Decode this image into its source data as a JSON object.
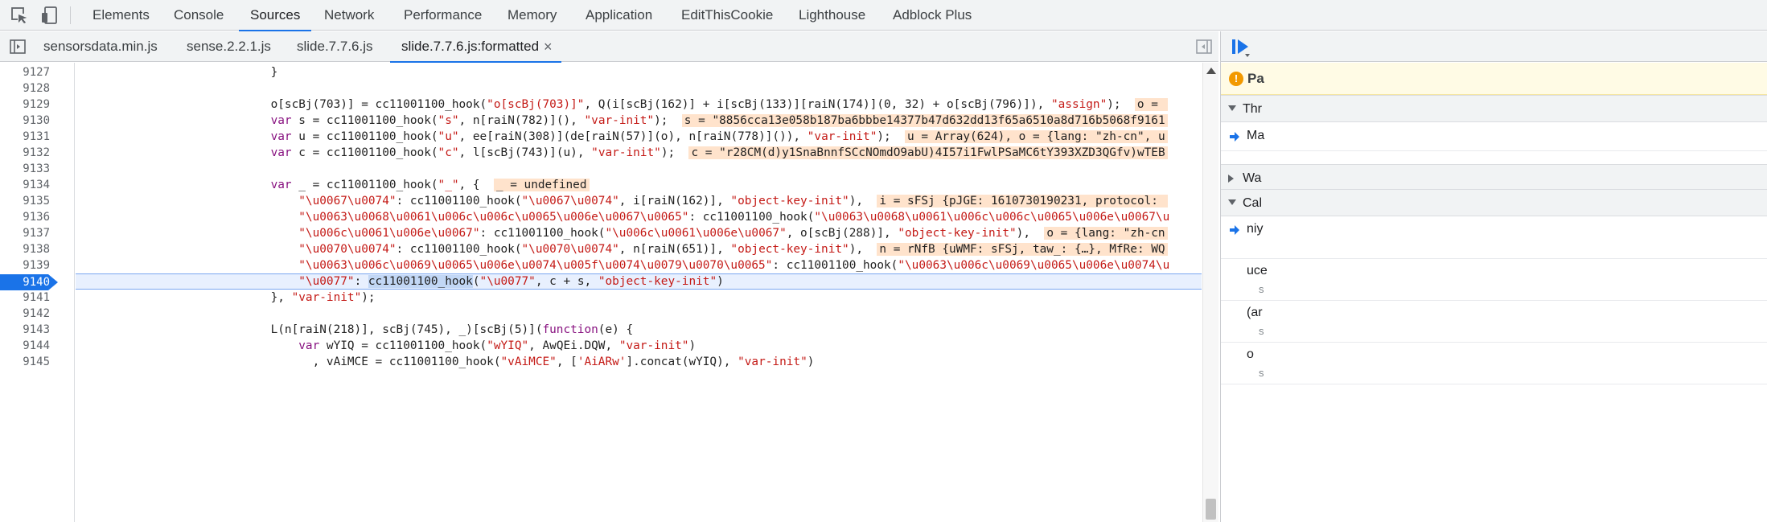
{
  "panel_tabs": [
    {
      "label": "Elements"
    },
    {
      "label": "Console"
    },
    {
      "label": "Sources"
    },
    {
      "label": "Network"
    },
    {
      "label": "Performance"
    },
    {
      "label": "Memory"
    },
    {
      "label": "Application"
    },
    {
      "label": "EditThisCookie"
    },
    {
      "label": "Lighthouse"
    },
    {
      "label": "Adblock Plus"
    }
  ],
  "active_panel": "Sources",
  "file_tabs": [
    {
      "label": "sensorsdata.min.js"
    },
    {
      "label": "sense.2.2.1.js"
    },
    {
      "label": "slide.7.7.6.js"
    },
    {
      "label": "slide.7.7.6.js:formatted"
    }
  ],
  "active_file": "slide.7.7.6.js:formatted",
  "file_close_glyph": "×",
  "line_numbers": [
    "9127",
    "9128",
    "9129",
    "9130",
    "9131",
    "9132",
    "9133",
    "9134",
    "9135",
    "9136",
    "9137",
    "9138",
    "9139",
    "9140",
    "9141",
    "9142",
    "9143",
    "9144",
    "9145"
  ],
  "current_line": "9140",
  "code": {
    "l9127": "                            }",
    "l9129_a": "                            o[scBj(703)] = cc11001100_hook(",
    "l9129_s1": "\"o[scBj(703)]\"",
    "l9129_b": ", Q(i[scBj(162)] + i[scBj(133)][raiN(174)](0, 32) + o[scBj(796)]), ",
    "l9129_s2": "\"assign\"",
    "l9129_c": ");  ",
    "l9129_v": "o = ",
    "l9130_kw": "                            var",
    "l9130_a": " s = cc11001100_hook(",
    "l9130_s1": "\"s\"",
    "l9130_b": ", n[raiN(782)](), ",
    "l9130_s2": "\"var-init\"",
    "l9130_c": ");  ",
    "l9130_v": "s = \"8856cca13e058b187ba6bbbe14377b47d632dd13f65a6510a8d716b5068f9161",
    "l9131_kw": "                            var",
    "l9131_a": " u = cc11001100_hook(",
    "l9131_s1": "\"u\"",
    "l9131_b": ", ee[raiN(308)](de[raiN(57)](o), n[raiN(778)]()), ",
    "l9131_s2": "\"var-init\"",
    "l9131_c": ");  ",
    "l9131_v": "u = Array(624), o = {lang: \"zh-cn\", u",
    "l9132_kw": "                            var",
    "l9132_a": " c = cc11001100_hook(",
    "l9132_s1": "\"c\"",
    "l9132_b": ", l[scBj(743)](u), ",
    "l9132_s2": "\"var-init\"",
    "l9132_c": ");  ",
    "l9132_v": "c = \"r28CM(d)y1SnaBnnfSCcNOmdO9abU)4I57i1FwlPSaMC6tY393XZD3QGfv)wTEB",
    "l9134_kw": "                            var",
    "l9134_a": " _ = cc11001100_hook(",
    "l9134_s1": "\"_\"",
    "l9134_b": ", {  ",
    "l9134_v": "_ = undefined",
    "l9135_s1": "                                \"\\u0067\\u0074\"",
    "l9135_a": ": cc11001100_hook(",
    "l9135_s2": "\"\\u0067\\u0074\"",
    "l9135_b": ", i[raiN(162)], ",
    "l9135_s3": "\"object-key-init\"",
    "l9135_c": "),  ",
    "l9135_v": "i = sFSj {pJGE: 1610730190231, protocol: ",
    "l9136_s1": "                                \"\\u0063\\u0068\\u0061\\u006c\\u006c\\u0065\\u006e\\u0067\\u0065\"",
    "l9136_a": ": cc11001100_hook(",
    "l9136_s2": "\"\\u0063\\u0068\\u0061\\u006c\\u006c\\u0065\\u006e\\u0067\\u",
    "l9137_s1": "                                \"\\u006c\\u0061\\u006e\\u0067\"",
    "l9137_a": ": cc11001100_hook(",
    "l9137_s2": "\"\\u006c\\u0061\\u006e\\u0067\"",
    "l9137_b": ", o[scBj(288)], ",
    "l9137_s3": "\"object-key-init\"",
    "l9137_c": "),  ",
    "l9137_v": "o = {lang: \"zh-cn",
    "l9138_s1": "                                \"\\u0070\\u0074\"",
    "l9138_a": ": cc11001100_hook(",
    "l9138_s2": "\"\\u0070\\u0074\"",
    "l9138_b": ", n[raiN(651)], ",
    "l9138_s3": "\"object-key-init\"",
    "l9138_c": "),  ",
    "l9138_v": "n = rNfB {uWMF: sFSj, taw_: {…}, MfRe: WQ",
    "l9139_s1": "                                \"\\u0063\\u006c\\u0069\\u0065\\u006e\\u0074\\u005f\\u0074\\u0079\\u0070\\u0065\"",
    "l9139_a": ": cc11001100_hook(",
    "l9139_s2": "\"\\u0063\\u006c\\u0069\\u0065\\u006e\\u0074\\u",
    "l9140_s1": "                                \"\\u0077\"",
    "l9140_a": ": ",
    "l9140_hl": "cc11001100_hook",
    "l9140_b": "(",
    "l9140_s2": "\"\\u0077\"",
    "l9140_c": ", c + s, ",
    "l9140_s3": "\"object-key-init\"",
    "l9140_d": ")",
    "l9141_a": "                            }, ",
    "l9141_s1": "\"var-init\"",
    "l9141_b": ");",
    "l9143_a": "                            L(n[raiN(218)], scBj(745), _)[scBj(5)](",
    "l9143_kw": "function",
    "l9143_b": "(e) {",
    "l9144_kw": "                                var",
    "l9144_a": " wYIQ = cc11001100_hook(",
    "l9144_s1": "\"wYIQ\"",
    "l9144_b": ", AwQEi.DQW, ",
    "l9144_s2": "\"var-init\"",
    "l9144_c": ")",
    "l9145_a": "                                  , vAiMCE = cc11001100_hook(",
    "l9145_s1": "\"vAiMCE\"",
    "l9145_b": ", [",
    "l9145_s2": "'AiARw'",
    "l9145_c": "].concat(wYIQ), ",
    "l9145_s3": "\"var-init\"",
    "l9145_d": ")"
  },
  "right_pane": {
    "paused_text": "Pa",
    "paused_icon": "!",
    "sections": [
      {
        "label": "Thr"
      },
      {
        "label": "Wa"
      },
      {
        "label": "Cal"
      }
    ],
    "threads_item": "Ma",
    "call_items": [
      {
        "name": "niy",
        "sub": ""
      },
      {
        "name": "uce",
        "sub": "s"
      },
      {
        "name": "(ar",
        "sub": "s"
      },
      {
        "name": "o",
        "sub": "s"
      }
    ]
  },
  "colors": {
    "accent": "#1a73e8",
    "keyword": "#881280",
    "string": "#c41a16",
    "number": "#1c00cf",
    "inline_value_bg": "#ffe3cc",
    "exec_line_bg": "#e8f0fe"
  }
}
